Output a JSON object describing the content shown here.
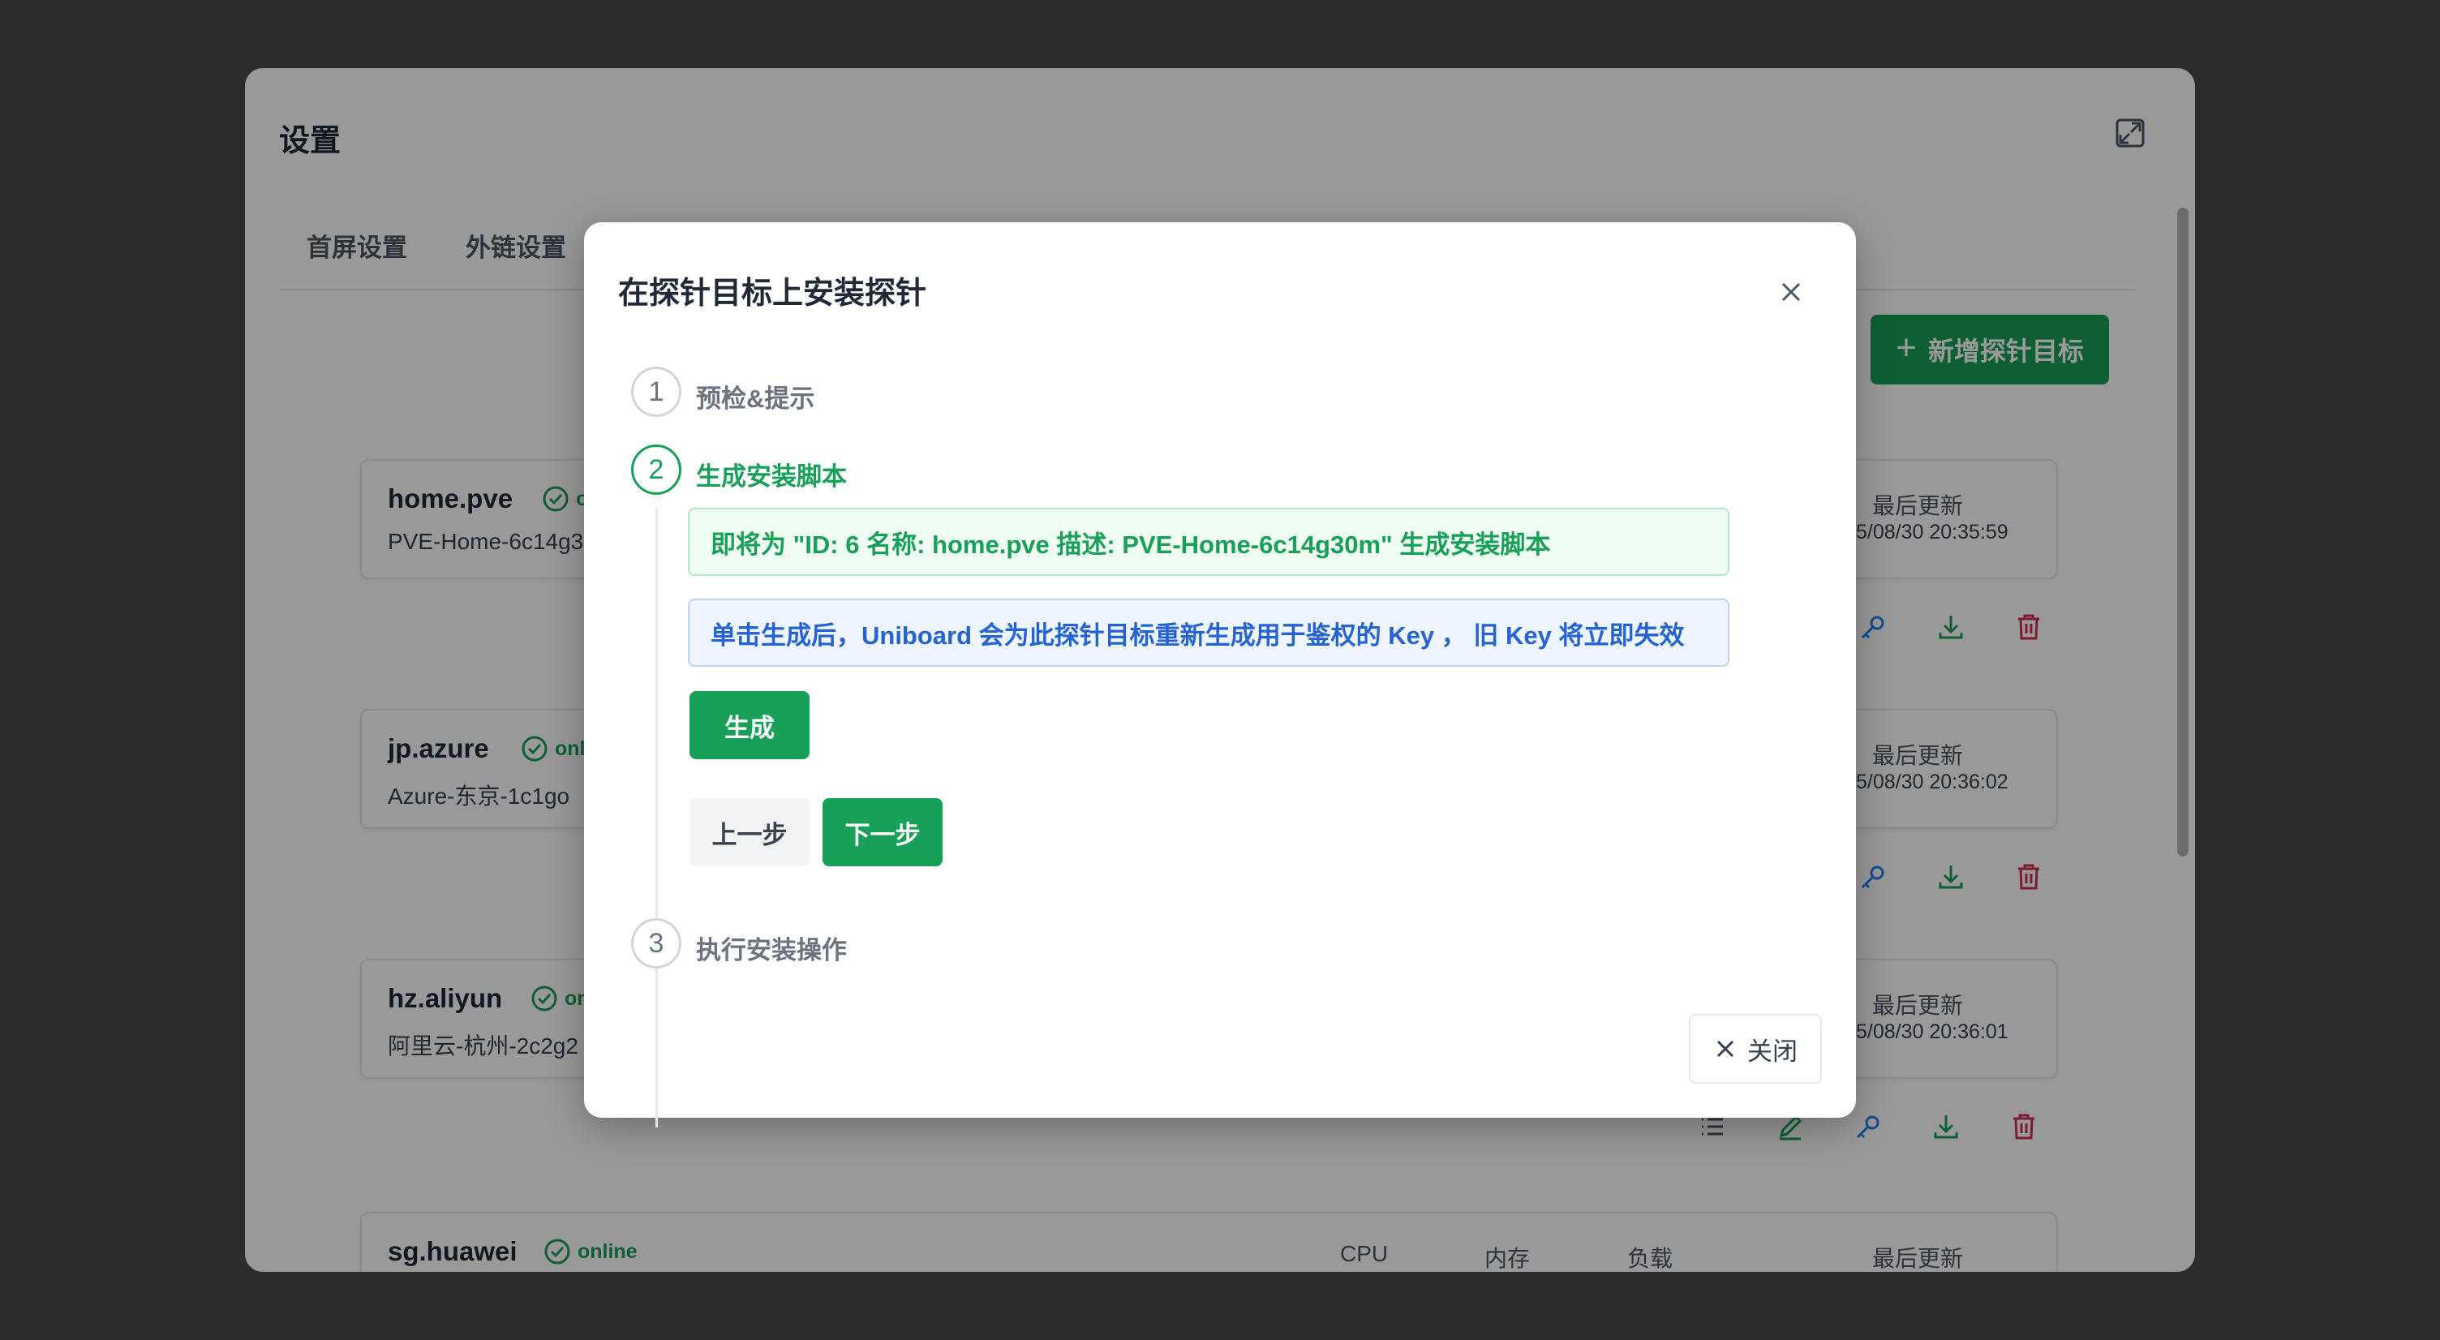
{
  "settings": {
    "title": "设置",
    "tabs": [
      {
        "label": "首屏设置"
      },
      {
        "label": "外链设置"
      }
    ],
    "add_target_label": "新增探针目标",
    "metric_labels": {
      "cpu": "CPU",
      "memory": "内存",
      "load": "负载",
      "last_update": "最后更新"
    },
    "cards": [
      {
        "name": "home.pve",
        "status": "onl",
        "desc": "PVE-Home-6c14g3",
        "last_update": "5/08/30 20:35:59"
      },
      {
        "name": "jp.azure",
        "status": "onli",
        "desc": "Azure-东京-1c1go",
        "last_update": "5/08/30 20:36:02"
      },
      {
        "name": "hz.aliyun",
        "status": "on",
        "desc": "阿里云-杭州-2c2g2",
        "last_update": "5/08/30 20:36:01"
      },
      {
        "name": "sg.huawei",
        "status": "online",
        "desc": "",
        "last_update": ""
      }
    ]
  },
  "modal": {
    "title": "在探针目标上安装探针",
    "steps": [
      {
        "number": "1",
        "title": "预检&提示"
      },
      {
        "number": "2",
        "title": "生成安装脚本"
      },
      {
        "number": "3",
        "title": "执行安装操作"
      }
    ],
    "success_alert": "即将为 \"ID: 6 名称: home.pve 描述: PVE-Home-6c14g30m\" 生成安装脚本",
    "info_alert": "单击生成后，Uniboard 会为此探针目标重新生成用于鉴权的 Key ， 旧 Key 将立即失效",
    "generate_label": "生成",
    "prev_label": "上一步",
    "next_label": "下一步",
    "close_label": "关闭"
  },
  "colors": {
    "primary": "#18a058",
    "info": "#2563d4",
    "danger": "#d03050",
    "key": "#2080f0"
  }
}
